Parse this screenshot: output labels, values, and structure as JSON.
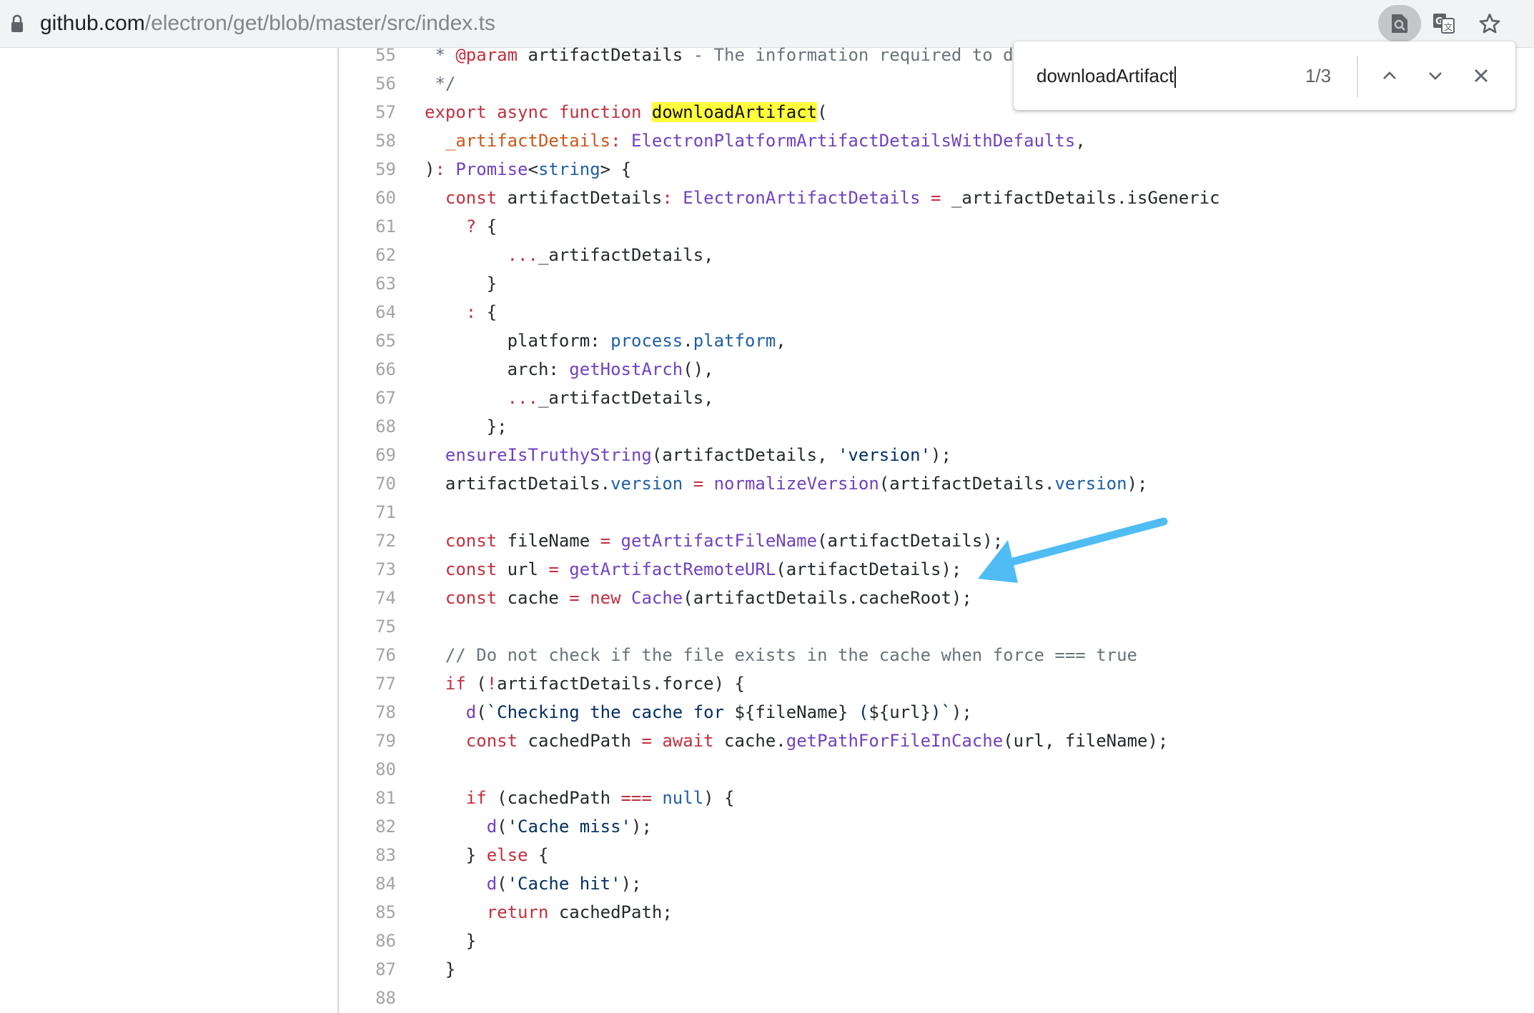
{
  "browser": {
    "url_host": "github.com",
    "url_path": "/electron/get/blob/master/src/index.ts",
    "icons": {
      "lock": "lock-icon",
      "find": "find-in-page-icon",
      "translate": "translate-icon",
      "bookmark": "star-icon"
    }
  },
  "find_bar": {
    "query": "downloadArtifact",
    "count": "1/3",
    "prev_icon": "chevron-up-icon",
    "next_icon": "chevron-down-icon",
    "close_icon": "close-icon"
  },
  "annotation": {
    "arrow_color": "#4fbdf4",
    "points_to_line": 73
  },
  "colors": {
    "keyword": "#c2303f",
    "function": "#6f42c1",
    "property": "#1f5fa8",
    "string": "#032f62",
    "parameter": "#c9581a",
    "comment": "#6a737d",
    "highlight": "#ffff3b"
  },
  "code": {
    "lines": [
      {
        "n": "55",
        "tokens": [
          [
            "c",
            " * "
          ],
          [
            "k",
            "@param"
          ],
          [
            "",
            " artifactDetails "
          ],
          [
            "c",
            "- The information required to d"
          ]
        ]
      },
      {
        "n": "56",
        "tokens": [
          [
            "c",
            " */"
          ]
        ]
      },
      {
        "n": "57",
        "tokens": [
          [
            "k",
            "export async function "
          ],
          [
            "hl",
            "downloadArtifact"
          ],
          [
            "",
            "("
          ]
        ]
      },
      {
        "n": "58",
        "tokens": [
          [
            "o",
            "  _artifactDetails"
          ],
          [
            "k",
            ": "
          ],
          [
            "p",
            "ElectronPlatformArtifactDetailsWithDefaults"
          ],
          [
            "",
            ","
          ]
        ]
      },
      {
        "n": "59",
        "tokens": [
          [
            "",
            ")"
          ],
          [
            "k",
            ": "
          ],
          [
            "p",
            "Promise"
          ],
          [
            "",
            "<"
          ],
          [
            "b",
            "string"
          ],
          [
            "",
            "> {"
          ]
        ]
      },
      {
        "n": "60",
        "tokens": [
          [
            "k",
            "  const "
          ],
          [
            "",
            "artifactDetails"
          ],
          [
            "k",
            ": "
          ],
          [
            "p",
            "ElectronArtifactDetails"
          ],
          [
            "k",
            " = "
          ],
          [
            "",
            "_artifactDetails.isGeneric"
          ]
        ]
      },
      {
        "n": "61",
        "tokens": [
          [
            "k",
            "    ? "
          ],
          [
            "",
            "{"
          ]
        ]
      },
      {
        "n": "62",
        "tokens": [
          [
            "k",
            "        ..."
          ],
          [
            "",
            "_artifactDetails,"
          ]
        ]
      },
      {
        "n": "63",
        "tokens": [
          [
            "",
            "      }"
          ]
        ]
      },
      {
        "n": "64",
        "tokens": [
          [
            "k",
            "    : "
          ],
          [
            "",
            "{"
          ]
        ]
      },
      {
        "n": "65",
        "tokens": [
          [
            "",
            "        platform: "
          ],
          [
            "b",
            "process"
          ],
          [
            "",
            "."
          ],
          [
            "b",
            "platform"
          ],
          [
            "",
            ","
          ]
        ]
      },
      {
        "n": "66",
        "tokens": [
          [
            "",
            "        arch: "
          ],
          [
            "p",
            "getHostArch"
          ],
          [
            "",
            "(),"
          ]
        ]
      },
      {
        "n": "67",
        "tokens": [
          [
            "k",
            "        ..."
          ],
          [
            "",
            "_artifactDetails,"
          ]
        ]
      },
      {
        "n": "68",
        "tokens": [
          [
            "",
            "      };"
          ]
        ]
      },
      {
        "n": "69",
        "tokens": [
          [
            "p",
            "  ensureIsTruthyString"
          ],
          [
            "",
            "(artifactDetails, "
          ],
          [
            "s",
            "'version'"
          ],
          [
            "",
            ");"
          ]
        ]
      },
      {
        "n": "70",
        "tokens": [
          [
            "",
            "  artifactDetails."
          ],
          [
            "b",
            "version"
          ],
          [
            "k",
            " = "
          ],
          [
            "p",
            "normalizeVersion"
          ],
          [
            "",
            "(artifactDetails."
          ],
          [
            "b",
            "version"
          ],
          [
            "",
            ");"
          ]
        ]
      },
      {
        "n": "71",
        "tokens": []
      },
      {
        "n": "72",
        "tokens": [
          [
            "k",
            "  const "
          ],
          [
            "",
            "fileName "
          ],
          [
            "k",
            "= "
          ],
          [
            "p",
            "getArtifactFileName"
          ],
          [
            "",
            "(artifactDetails);"
          ]
        ]
      },
      {
        "n": "73",
        "tokens": [
          [
            "k",
            "  const "
          ],
          [
            "",
            "url "
          ],
          [
            "k",
            "= "
          ],
          [
            "p",
            "getArtifactRemoteURL"
          ],
          [
            "",
            "(artifactDetails);"
          ]
        ]
      },
      {
        "n": "74",
        "tokens": [
          [
            "k",
            "  const "
          ],
          [
            "",
            "cache "
          ],
          [
            "k",
            "= new "
          ],
          [
            "p",
            "Cache"
          ],
          [
            "",
            "(artifactDetails.cacheRoot);"
          ]
        ]
      },
      {
        "n": "75",
        "tokens": []
      },
      {
        "n": "76",
        "tokens": [
          [
            "c",
            "  // Do not check if the file exists in the cache when force === true"
          ]
        ]
      },
      {
        "n": "77",
        "tokens": [
          [
            "k",
            "  if "
          ],
          [
            "",
            "("
          ],
          [
            "k",
            "!"
          ],
          [
            "",
            "artifactDetails.force) {"
          ]
        ]
      },
      {
        "n": "78",
        "tokens": [
          [
            "p",
            "    d"
          ],
          [
            "",
            "("
          ],
          [
            "s",
            "`Checking the cache for "
          ],
          [
            "",
            "${fileName}"
          ],
          [
            "s",
            " ("
          ],
          [
            "",
            "${url}"
          ],
          [
            "s",
            ")`"
          ],
          [
            "",
            ");"
          ]
        ]
      },
      {
        "n": "79",
        "tokens": [
          [
            "k",
            "    const "
          ],
          [
            "",
            "cachedPath "
          ],
          [
            "k",
            "= await "
          ],
          [
            "",
            "cache."
          ],
          [
            "p",
            "getPathForFileInCache"
          ],
          [
            "",
            "(url, fileName);"
          ]
        ]
      },
      {
        "n": "80",
        "tokens": []
      },
      {
        "n": "81",
        "tokens": [
          [
            "k",
            "    if "
          ],
          [
            "",
            "(cachedPath "
          ],
          [
            "k",
            "==="
          ],
          [
            "b",
            " null"
          ],
          [
            "",
            ") {"
          ]
        ]
      },
      {
        "n": "82",
        "tokens": [
          [
            "p",
            "      d"
          ],
          [
            "",
            "("
          ],
          [
            "s",
            "'Cache miss'"
          ],
          [
            "",
            ");"
          ]
        ]
      },
      {
        "n": "83",
        "tokens": [
          [
            "",
            "    } "
          ],
          [
            "k",
            "else "
          ],
          [
            "",
            "{"
          ]
        ]
      },
      {
        "n": "84",
        "tokens": [
          [
            "p",
            "      d"
          ],
          [
            "",
            "("
          ],
          [
            "s",
            "'Cache hit'"
          ],
          [
            "",
            ");"
          ]
        ]
      },
      {
        "n": "85",
        "tokens": [
          [
            "k",
            "      return "
          ],
          [
            "",
            "cachedPath;"
          ]
        ]
      },
      {
        "n": "86",
        "tokens": [
          [
            "",
            "    }"
          ]
        ]
      },
      {
        "n": "87",
        "tokens": [
          [
            "",
            "  }"
          ]
        ]
      },
      {
        "n": "88",
        "tokens": []
      }
    ]
  }
}
